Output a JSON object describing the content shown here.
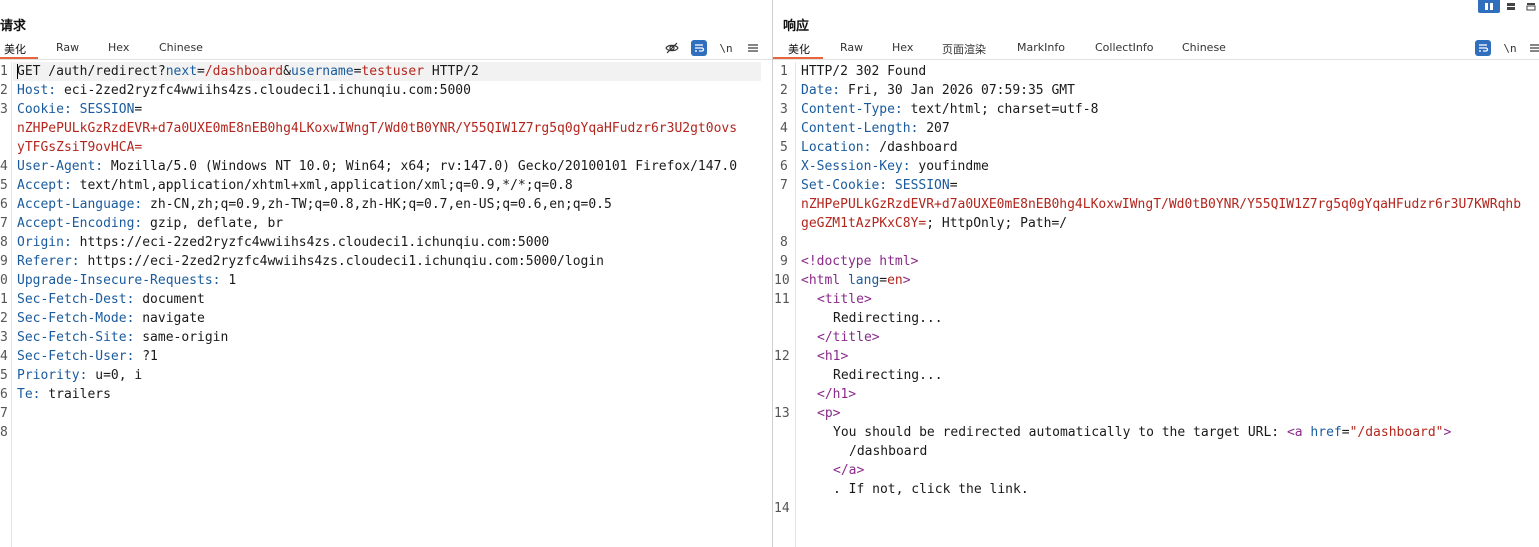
{
  "request": {
    "title": "请求",
    "tabs": [
      "美化",
      "Raw",
      "Hex",
      "Chinese"
    ],
    "active_tab": "美化",
    "tools": {
      "hide_icon": "eye-off-icon",
      "wrap_icon": "wrap-lines-icon",
      "newline_label": "\\n",
      "menu_icon": "menu-icon"
    },
    "line_numbers": [
      "1",
      "2",
      "3",
      "",
      "4",
      "5",
      "6",
      "7",
      "8",
      "9",
      "0",
      "1",
      "2",
      "3",
      "4",
      "5",
      "6",
      "7",
      "8"
    ],
    "lines": {
      "l1": {
        "method": "GET /auth/redirect?",
        "p1": "next",
        "eq1": "=",
        "v1": "/dashboard",
        "amp": "&",
        "p2": "username",
        "eq2": "=",
        "v2": "testuser",
        "tail": " HTTP/2"
      },
      "host": {
        "k": "Host:",
        "v": " eci-2zed2ryzfc4wwiihs4zs.cloudeci1.ichunqiu.com:5000"
      },
      "cookie": {
        "k": "Cookie:",
        "k2": " SESSION",
        "eq": "="
      },
      "cookie_v1": "nZHPePULkGzRzdEVR+d7a0UXE0mE8nEB0hg4LKoxwIWngT/Wd0tB0YNR/Y55QIW1Z7rg5q0gYqaHFudzr6r3U2gt0ovs",
      "cookie_v2": "yTFGsZsiT9ovHCA=",
      "ua": {
        "k": "User-Agent:",
        "v": " Mozilla/5.0 (Windows NT 10.0; Win64; x64; rv:147.0) Gecko/20100101 Firefox/147.0"
      },
      "accept": {
        "k": "Accept:",
        "v": " text/html,application/xhtml+xml,application/xml;q=0.9,*/*;q=0.8"
      },
      "accept_lang": {
        "k": "Accept-Language:",
        "v": " zh-CN,zh;q=0.9,zh-TW;q=0.8,zh-HK;q=0.7,en-US;q=0.6,en;q=0.5"
      },
      "accept_enc": {
        "k": "Accept-Encoding:",
        "v": " gzip, deflate, br"
      },
      "origin": {
        "k": "Origin:",
        "v": " https://eci-2zed2ryzfc4wwiihs4zs.cloudeci1.ichunqiu.com:5000"
      },
      "referer": {
        "k": "Referer:",
        "v": " https://eci-2zed2ryzfc4wwiihs4zs.cloudeci1.ichunqiu.com:5000/login"
      },
      "uir": {
        "k": "Upgrade-Insecure-Requests:",
        "v": " 1"
      },
      "sfd": {
        "k": "Sec-Fetch-Dest:",
        "v": " document"
      },
      "sfm": {
        "k": "Sec-Fetch-Mode:",
        "v": " navigate"
      },
      "sfs": {
        "k": "Sec-Fetch-Site:",
        "v": " same-origin"
      },
      "sfu": {
        "k": "Sec-Fetch-User:",
        "v": " ?1"
      },
      "prio": {
        "k": "Priority:",
        "v": " u=0, i"
      },
      "te": {
        "k": "Te:",
        "v": " trailers"
      }
    }
  },
  "response": {
    "title": "响应",
    "tabs": [
      "美化",
      "Raw",
      "Hex",
      "页面渲染",
      "MarkInfo",
      "CollectInfo",
      "Chinese"
    ],
    "active_tab": "美化",
    "tools": {
      "wrap_icon": "wrap-lines-icon",
      "newline_label": "\\n",
      "menu_icon": "menu-icon"
    },
    "line_numbers": [
      "1",
      "2",
      "3",
      "4",
      "5",
      "6",
      "7",
      "",
      "8",
      "9",
      "10",
      "11",
      "",
      "",
      "12",
      "",
      "",
      "13",
      "",
      "",
      "",
      "",
      "14"
    ],
    "lines": {
      "status": "HTTP/2 302 Found",
      "date": {
        "k": "Date:",
        "v": " Fri, 30 Jan 2026 07:59:35 GMT"
      },
      "ctype": {
        "k": "Content-Type:",
        "v": " text/html; charset=utf-8"
      },
      "clen": {
        "k": "Content-Length:",
        "v": " 207"
      },
      "loc": {
        "k": "Location:",
        "v": " /dashboard"
      },
      "xsk": {
        "k": "X-Session-Key:",
        "v": " youfindme"
      },
      "setc": {
        "k": "Set-Cookie:",
        "k2": " SESSION",
        "eq": "="
      },
      "setc_v1": "nZHPePULkGzRzdEVR+d7a0UXE0mE8nEB0hg4LKoxwIWngT/Wd0tB0YNR/Y55QIW1Z7rg5q0gYqaHFudzr6r3U7KWRqhb",
      "setc_v2a": "geGZM1tAzPKxC8Y=",
      "setc_v2b": "; HttpOnly; Path=/",
      "doctype": "<!doctype html>",
      "html_open": {
        "lt": "<",
        "tag": "html",
        "attr": " lang",
        "eq": "=",
        "val": "en",
        "gt": ">"
      },
      "title_open": "<title>",
      "title_text": "Redirecting...",
      "title_close": "</title>",
      "h1_open": "<h1>",
      "h1_text": "Redirecting...",
      "h1_close": "</h1>",
      "p_open": "<p>",
      "p_text": "You should be redirected automatically to the target URL: ",
      "a_lt": "<",
      "a_tag": "a",
      "a_attr": " href",
      "a_eq": "=",
      "a_val": "\"/dashboard\"",
      "a_gt": ">",
      "a_text": "/dashboard",
      "a_close": "</a>",
      "p_tail": ". If not, click the link."
    }
  },
  "layout_toggles": [
    "split-horizontal-icon",
    "split-vertical-icon",
    "single-pane-icon"
  ],
  "colors": {
    "accent": "#e8643a",
    "header_key": "#1a5b9e",
    "param_value": "#b3261e",
    "tag": "#8a2a8a",
    "toggle_active": "#2f6fbd"
  }
}
